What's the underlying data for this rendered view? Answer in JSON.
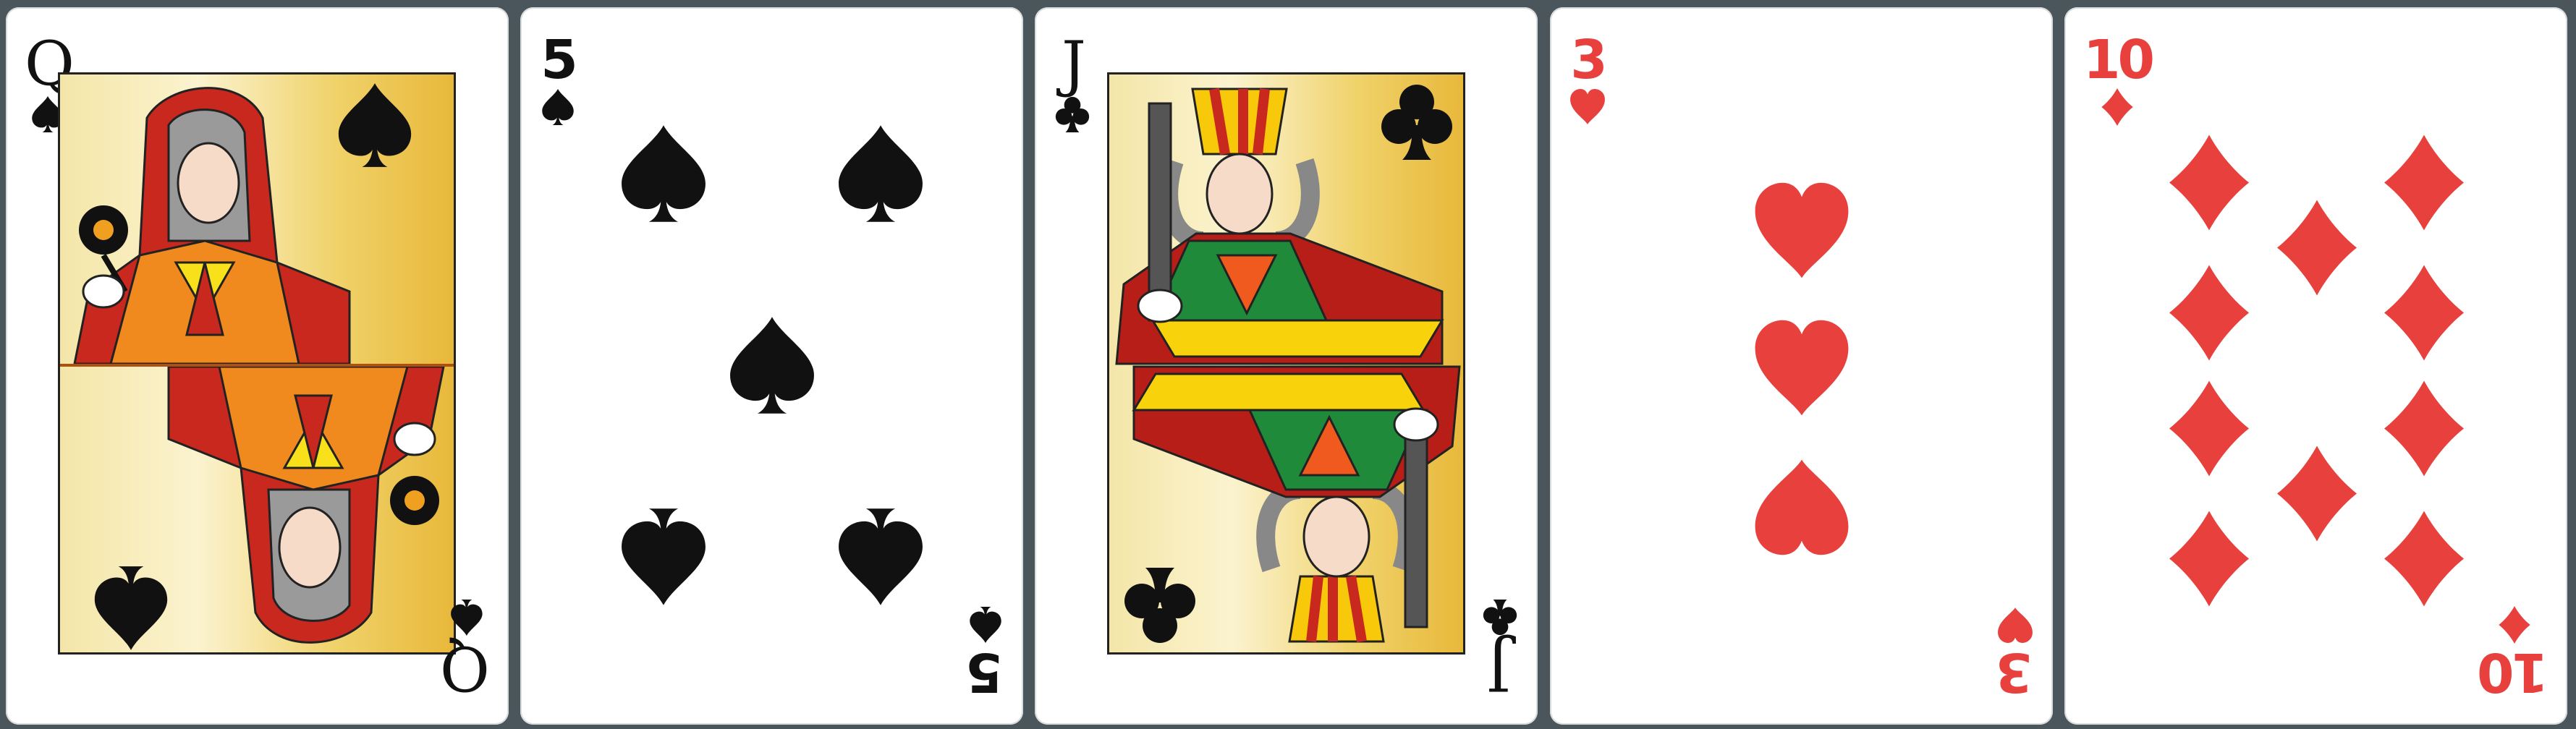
{
  "scene": "poker-hand",
  "colors": {
    "black": "#111111",
    "red": "#e8413d",
    "table": "#4a565c"
  },
  "cards": [
    {
      "rank": "Q",
      "suit": "spades",
      "suit_icon": "spade-icon",
      "color": "black"
    },
    {
      "rank": "5",
      "suit": "spades",
      "suit_icon": "spade-icon",
      "color": "black"
    },
    {
      "rank": "J",
      "suit": "clubs",
      "suit_icon": "club-icon",
      "color": "black"
    },
    {
      "rank": "3",
      "suit": "hearts",
      "suit_icon": "heart-icon",
      "color": "red"
    },
    {
      "rank": "10",
      "suit": "diamonds",
      "suit_icon": "diamond-icon",
      "color": "red"
    }
  ]
}
